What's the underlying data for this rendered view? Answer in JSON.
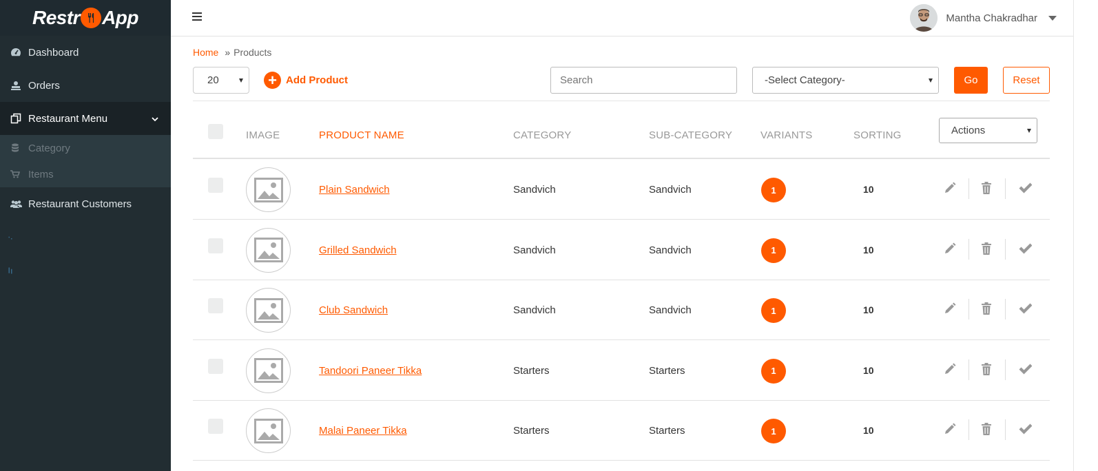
{
  "brand": {
    "prefix": "Restr",
    "suffix": "App"
  },
  "sidebar": {
    "items": [
      {
        "label": "Dashboard",
        "icon": "dashboard-icon"
      },
      {
        "label": "Orders",
        "icon": "orders-icon"
      },
      {
        "label": "Restaurant Menu",
        "icon": "menu-copy-icon",
        "expanded": true
      },
      {
        "label": "Restaurant Customers",
        "icon": "users-icon"
      }
    ],
    "submenu": [
      {
        "label": "Category",
        "icon": "database-icon"
      },
      {
        "label": "Items",
        "icon": "cart-icon"
      }
    ]
  },
  "topbar": {
    "user_name": "Mantha Chakradhar"
  },
  "breadcrumb": {
    "home": "Home",
    "separator": "»",
    "current": "Products"
  },
  "toolbar": {
    "page_size": "20",
    "add_product": "Add Product",
    "search_placeholder": "Search",
    "category_select": "-Select Category-",
    "go": "Go",
    "reset": "Reset"
  },
  "table": {
    "headers": {
      "image": "IMAGE",
      "product_name": "PRODUCT NAME",
      "category": "CATEGORY",
      "sub_category": "SUB-CATEGORY",
      "variants": "VARIANTS",
      "sorting": "SORTING",
      "actions": "Actions"
    },
    "rows": [
      {
        "name": "Plain Sandwich",
        "category": "Sandvich",
        "sub_category": "Sandvich",
        "variants": "1",
        "sorting": "10"
      },
      {
        "name": "Grilled Sandwich",
        "category": "Sandvich",
        "sub_category": "Sandvich",
        "variants": "1",
        "sorting": "10"
      },
      {
        "name": "Club Sandwich",
        "category": "Sandvich",
        "sub_category": "Sandvich",
        "variants": "1",
        "sorting": "10"
      },
      {
        "name": "Tandoori Paneer Tikka",
        "category": "Starters",
        "sub_category": "Starters",
        "variants": "1",
        "sorting": "10"
      },
      {
        "name": "Malai Paneer Tikka",
        "category": "Starters",
        "sub_category": "Starters",
        "variants": "1",
        "sorting": "10"
      }
    ]
  },
  "colors": {
    "accent": "#ff5a00",
    "sidebar": "#222d32"
  }
}
